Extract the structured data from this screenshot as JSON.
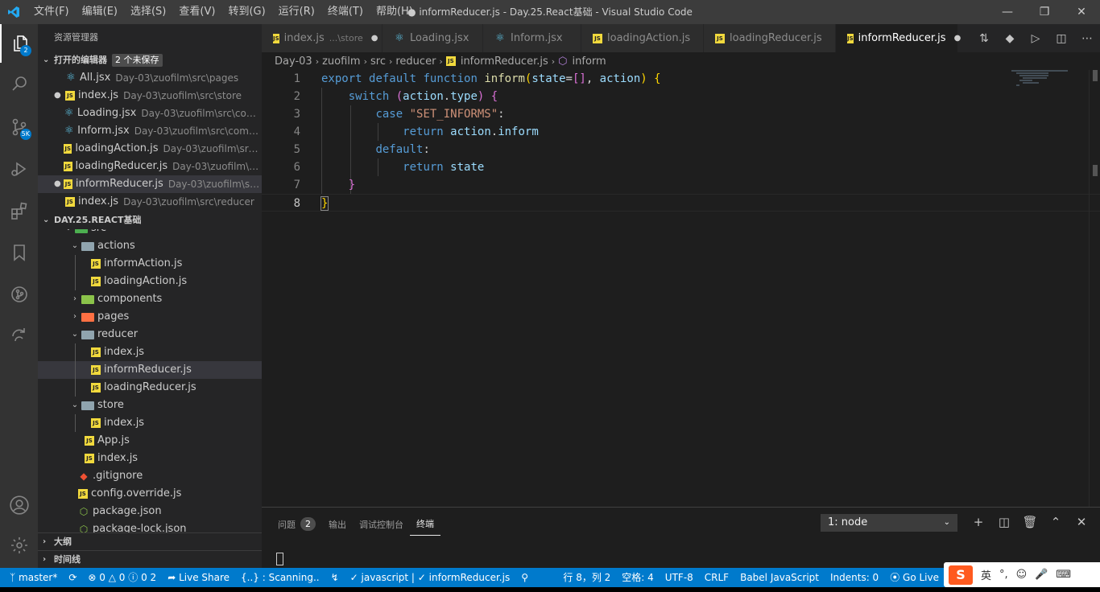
{
  "window": {
    "title": "● informReducer.js - Day.25.React基础 - Visual Studio Code",
    "menu": [
      "文件(F)",
      "编辑(E)",
      "选择(S)",
      "查看(V)",
      "转到(G)",
      "运行(R)",
      "终端(T)",
      "帮助(H)"
    ]
  },
  "activity": {
    "explorer_badge": "2",
    "scm_badge": "5K"
  },
  "sidebar": {
    "title": "资源管理器",
    "open_editors": {
      "header": "打开的编辑器",
      "dirty_badge": "2 个未保存",
      "items": [
        {
          "name": "All.jsx",
          "path": "Day-03\\zuofilm\\src\\pages",
          "icon": "react-icon",
          "dirty": false
        },
        {
          "name": "index.js",
          "path": "Day-03\\zuofilm\\src\\store",
          "icon": "js-icon",
          "dirty": true
        },
        {
          "name": "Loading.jsx",
          "path": "Day-03\\zuofilm\\src\\compo...",
          "icon": "react-icon",
          "dirty": false
        },
        {
          "name": "Inform.jsx",
          "path": "Day-03\\zuofilm\\src\\compon...",
          "icon": "react-icon",
          "dirty": false
        },
        {
          "name": "loadingAction.js",
          "path": "Day-03\\zuofilm\\src\\ac...",
          "icon": "js-icon",
          "dirty": false
        },
        {
          "name": "loadingReducer.js",
          "path": "Day-03\\zuofilm\\src\\...",
          "icon": "js-icon",
          "dirty": false
        },
        {
          "name": "informReducer.js",
          "path": "Day-03\\zuofilm\\src\\r...",
          "icon": "js-icon",
          "dirty": true
        },
        {
          "name": "index.js",
          "path": "Day-03\\zuofilm\\src\\reducer",
          "icon": "js-icon",
          "dirty": false
        }
      ]
    },
    "workspace_header": "DAY.25.REACT基础",
    "tree": [
      {
        "label": "src"
      },
      {
        "label": "actions"
      },
      {
        "label": "informAction.js"
      },
      {
        "label": "loadingAction.js"
      },
      {
        "label": "components"
      },
      {
        "label": "pages"
      },
      {
        "label": "reducer"
      },
      {
        "label": "index.js"
      },
      {
        "label": "informReducer.js"
      },
      {
        "label": "loadingReducer.js"
      },
      {
        "label": "store"
      },
      {
        "label": "index.js"
      },
      {
        "label": "App.js"
      },
      {
        "label": "index.js"
      },
      {
        "label": ".gitignore"
      },
      {
        "label": "config.override.js"
      },
      {
        "label": "package.json"
      },
      {
        "label": "package-lock.json"
      }
    ],
    "outline_header": "大纲",
    "timeline_header": "时间线"
  },
  "tabs": [
    {
      "name": "index.js",
      "desc": "...\\store",
      "icon": "js-icon",
      "dirty": true,
      "active": false
    },
    {
      "name": "Loading.jsx",
      "desc": "",
      "icon": "react-icon",
      "dirty": false,
      "active": false
    },
    {
      "name": "Inform.jsx",
      "desc": "",
      "icon": "react-icon",
      "dirty": false,
      "active": false
    },
    {
      "name": "loadingAction.js",
      "desc": "",
      "icon": "js-icon",
      "dirty": false,
      "active": false
    },
    {
      "name": "loadingReducer.js",
      "desc": "",
      "icon": "js-icon",
      "dirty": false,
      "active": false
    },
    {
      "name": "informReducer.js",
      "desc": "",
      "icon": "js-icon",
      "dirty": true,
      "active": true
    }
  ],
  "breadcrumb": [
    "Day-03",
    "zuofilm",
    "src",
    "reducer",
    "informReducer.js",
    "inform"
  ],
  "editor": {
    "line_numbers": [
      "1",
      "2",
      "3",
      "4",
      "5",
      "6",
      "7",
      "8"
    ],
    "current_line": 8
  },
  "panel": {
    "tabs": [
      "问题",
      "输出",
      "调试控制台",
      "终端"
    ],
    "problems_count": "2",
    "active_tab": "终端",
    "terminal_select": "1: node"
  },
  "statusbar": {
    "branch": "master*",
    "errors": "0",
    "warnings": "0",
    "info_a": "0",
    "info_b": "2",
    "live_share": "Live Share",
    "scanning": "{..} : Scanning..",
    "lang_check": "javascript |",
    "file_check": "informReducer.js",
    "position": "行 8，列 2",
    "spaces": "空格: 4",
    "encoding": "UTF-8",
    "eol": "CRLF",
    "language": "Babel JavaScript",
    "indents": "Indents: 0",
    "golive": "Go Live"
  },
  "ime": {
    "logo": "S",
    "mode": "英"
  },
  "colors": {
    "accent": "#007acc",
    "titlebar": "#3c3c3c",
    "activitybar": "#333333",
    "sidebar": "#252526",
    "editor": "#1e1e1e"
  }
}
